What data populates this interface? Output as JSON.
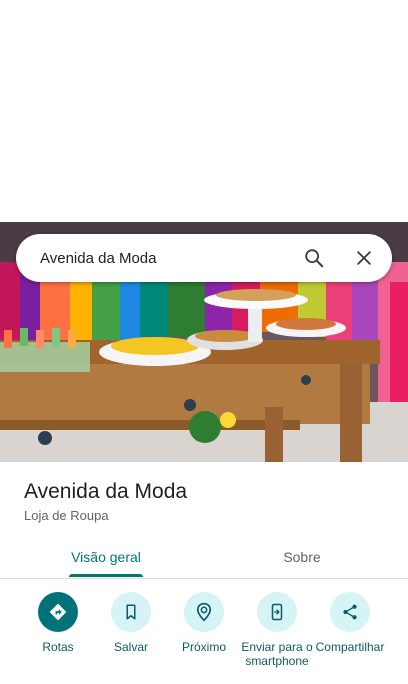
{
  "search": {
    "query": "Avenida da Moda"
  },
  "place": {
    "title": "Avenida da Moda",
    "category": "Loja de Roupa"
  },
  "tabs": [
    {
      "label": "Visão geral",
      "active": true
    },
    {
      "label": "Sobre",
      "active": false
    }
  ],
  "actions": [
    {
      "label": "Rotas",
      "icon": "directions-icon"
    },
    {
      "label": "Salvar",
      "icon": "bookmark-icon"
    },
    {
      "label": "Próximo",
      "icon": "nearby-icon"
    },
    {
      "label": "Enviar para o smartphone",
      "icon": "send-to-phone-icon"
    },
    {
      "label": "Compartilhar",
      "icon": "share-icon"
    }
  ],
  "colors": {
    "accent": "#00796b",
    "primary_action": "#00737a",
    "action_bg": "#d6f3f5",
    "action_text": "#0b5c63"
  }
}
